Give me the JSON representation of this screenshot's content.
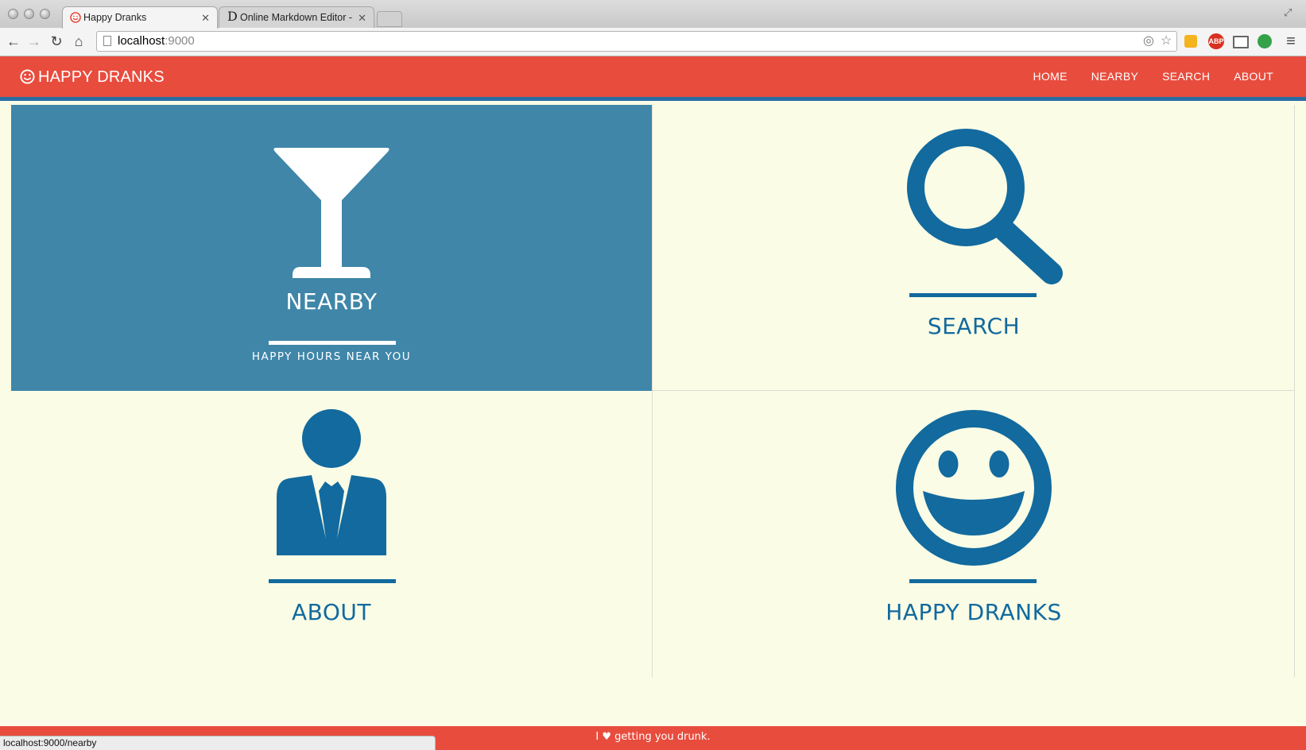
{
  "browser": {
    "tabs": [
      {
        "title": "Happy Dranks",
        "active": true
      },
      {
        "title": "Online Markdown Editor -",
        "active": false
      }
    ],
    "url_host": "localhost",
    "url_port": ":9000",
    "status_url": "localhost:9000/nearby",
    "extension_abp": "ABP"
  },
  "app": {
    "brand": "HAPPY DRANKS",
    "nav": [
      "HOME",
      "NEARBY",
      "SEARCH",
      "ABOUT"
    ],
    "tiles": {
      "nearby": {
        "title": "NEARBY",
        "subtitle": "HAPPY HOURS NEAR YOU"
      },
      "search": {
        "title": "SEARCH"
      },
      "about": {
        "title": "ABOUT"
      },
      "happy": {
        "title": "HAPPY DRANKS"
      }
    },
    "footer": {
      "prefix": "I ",
      "heart": "♥",
      "suffix": " getting you drunk."
    }
  },
  "colors": {
    "header": "#e84c3d",
    "header_border": "#2b6da3",
    "tile_active": "#3f86a9",
    "icon_blue": "#126a9e",
    "background": "#fafce6"
  }
}
